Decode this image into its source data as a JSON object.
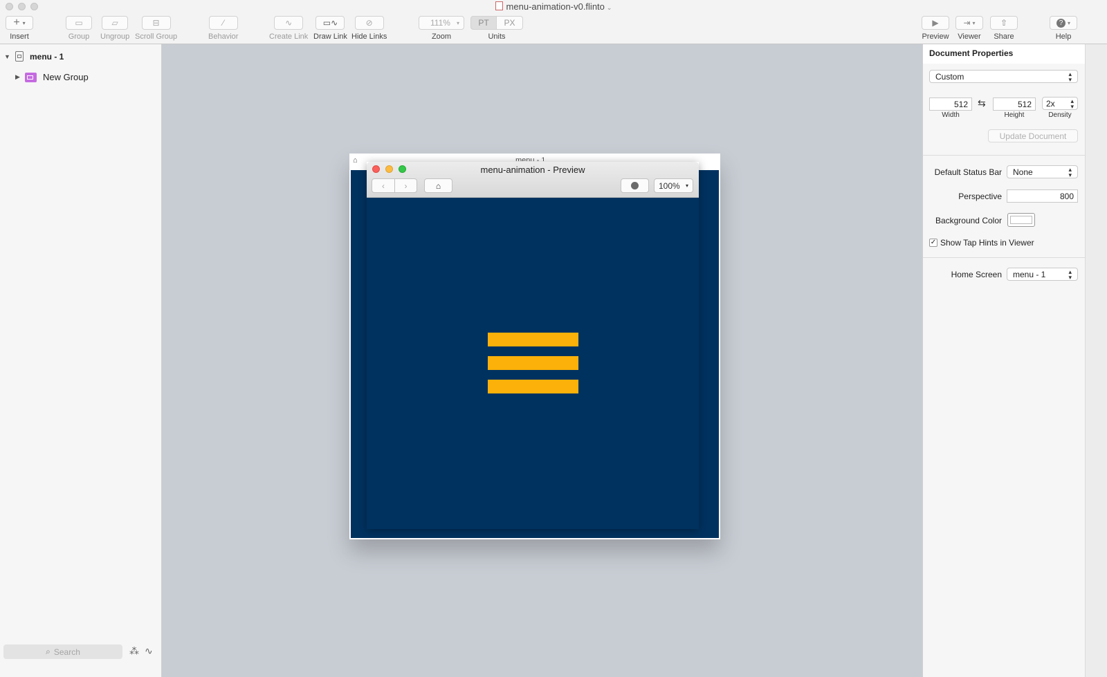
{
  "window": {
    "title": "menu-animation-v0.flinto"
  },
  "toolbar": {
    "insert_label": "Insert",
    "group_label": "Group",
    "ungroup_label": "Ungroup",
    "scroll_group_label": "Scroll Group",
    "behavior_label": "Behavior",
    "create_link_label": "Create Link",
    "draw_link_label": "Draw Link",
    "hide_links_label": "Hide Links",
    "zoom_value": "111%",
    "zoom_label": "Zoom",
    "units_pt": "PT",
    "units_px": "PX",
    "units_label": "Units",
    "preview_label": "Preview",
    "viewer_label": "Viewer",
    "share_label": "Share",
    "help_label": "Help",
    "icons": [
      "plus-icon",
      "folder-icon",
      "folder-open-icon",
      "scroll-group-icon",
      "wand-icon",
      "link-icon",
      "draw-link-icon",
      "eye-off-icon",
      "play-icon",
      "viewer-icon",
      "share-icon",
      "help-icon"
    ]
  },
  "layers": {
    "items": [
      {
        "label": "menu - 1",
        "type": "screen",
        "expanded": true
      },
      {
        "label": "New Group",
        "type": "group",
        "expanded": false
      }
    ],
    "search_placeholder": "Search"
  },
  "canvas": {
    "artboard_name": "menu - 1",
    "background_color": "#c8cdd4",
    "artboard_fill": "#003260"
  },
  "preview": {
    "title": "menu-animation - Preview",
    "zoom": "100%",
    "content_bg": "#003260",
    "burger_color": "#fbb109"
  },
  "inspector": {
    "title": "Document Properties",
    "preset": "Custom",
    "width": "512",
    "width_label": "Width",
    "height": "512",
    "height_label": "Height",
    "density": "2x",
    "density_label": "Density",
    "update_button": "Update Document",
    "status_bar_label": "Default Status Bar",
    "status_bar_value": "None",
    "perspective_label": "Perspective",
    "perspective_value": "800",
    "bg_color_label": "Background Color",
    "tap_hints_label": "Show Tap Hints in Viewer",
    "tap_hints_checked": true,
    "home_screen_label": "Home Screen",
    "home_screen_value": "menu - 1"
  }
}
